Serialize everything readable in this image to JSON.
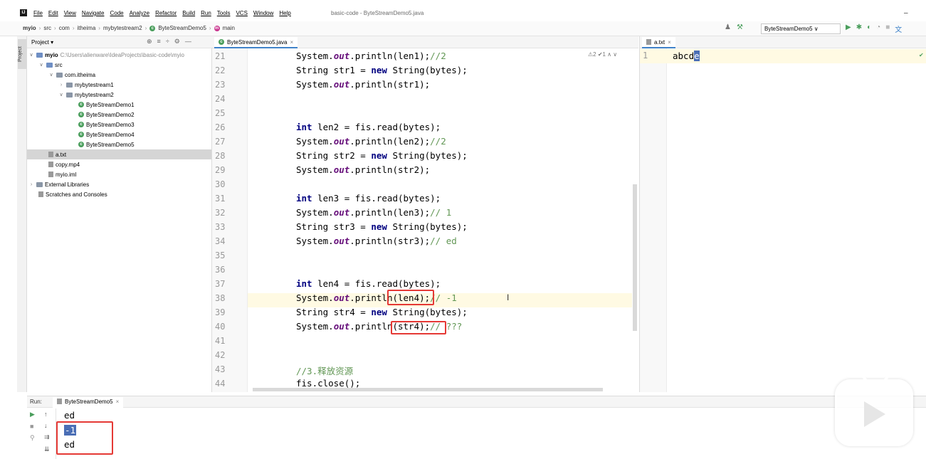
{
  "window": {
    "logo": "IJ",
    "title": "basic-code - ByteStreamDemo5.java",
    "menu": [
      "File",
      "Edit",
      "View",
      "Navigate",
      "Code",
      "Analyze",
      "Refactor",
      "Build",
      "Run",
      "Tools",
      "VCS",
      "Window",
      "Help"
    ],
    "minimize": "–"
  },
  "navbar": {
    "breadcrumbs": [
      "myio",
      "src",
      "com",
      "itheima",
      "mybytestream2",
      "ByteStreamDemo5",
      "main"
    ],
    "run_config": "ByteStreamDemo5 ∨"
  },
  "project": {
    "side_tab": "Project",
    "header": "Project ▾",
    "root_name": "myio",
    "root_path": "C:\\Users\\alienware\\IdeaProjects\\basic-code\\myio",
    "src": "src",
    "package": "com.itheima",
    "pkg1": "mybytestream1",
    "pkg2": "mybytestream2",
    "classes": [
      "ByteStreamDemo1",
      "ByteStreamDemo2",
      "ByteStreamDemo3",
      "ByteStreamDemo4",
      "ByteStreamDemo5"
    ],
    "files": [
      "a.txt",
      "copy.mp4",
      "myio.iml"
    ],
    "external": "External Libraries",
    "scratches": "Scratches and Consoles"
  },
  "editor": {
    "tab": "ByteStreamDemo5.java",
    "inspect": "⚠2 ✔1 ∧ ∨",
    "line_numbers": [
      "21",
      "22",
      "23",
      "24",
      "25",
      "26",
      "27",
      "28",
      "29",
      "30",
      "31",
      "32",
      "33",
      "34",
      "35",
      "36",
      "37",
      "38",
      "39",
      "40",
      "41",
      "42",
      "43",
      "44"
    ],
    "lines": {
      "l21a": "System.",
      "l21b": "out",
      "l21c": ".println(len1);",
      "l21d": "//2",
      "l22a": "String str1 = ",
      "l22b": "new",
      "l22c": " String(bytes);",
      "l23a": "System.",
      "l23b": "out",
      "l23c": ".println(str1);",
      "l26a": "int",
      "l26b": " len2 = fis.read(bytes);",
      "l27a": "System.",
      "l27b": "out",
      "l27c": ".println(len2);",
      "l27d": "//2",
      "l28a": "String str2 = ",
      "l28b": "new",
      "l28c": " String(bytes);",
      "l29a": "System.",
      "l29b": "out",
      "l29c": ".println(str2);",
      "l31a": "int",
      "l31b": " len3 = fis.read(bytes);",
      "l32a": "System.",
      "l32b": "out",
      "l32c": ".println(len3);",
      "l32d": "// 1",
      "l33a": "String str3 = ",
      "l33b": "new",
      "l33c": " String(bytes);",
      "l34a": "System.",
      "l34b": "out",
      "l34c": ".println(str3);",
      "l34d": "// ed",
      "l37a": "int",
      "l37b": " len4 = fis.read(bytes);",
      "l38a": "System.",
      "l38b": "out",
      "l38c": ".println(len4);",
      "l38d": "// -1",
      "l39a": "String str4 = ",
      "l39b": "new",
      "l39c": " String(bytes);",
      "l40a": "System.",
      "l40b": "out",
      "l40c": ".println(str4);",
      "l40d": "// ???",
      "l43": "//3.释放资源",
      "l44": "fis.close();"
    }
  },
  "txt": {
    "tab": "a.txt",
    "line_no": "1",
    "text_plain": "abcd",
    "text_sel": "e"
  },
  "run": {
    "label": "Run:",
    "tab": "ByteStreamDemo5",
    "output": [
      "ed",
      "-1",
      "ed"
    ]
  },
  "colors": {
    "accent": "#4083c9",
    "keyword": "#000080",
    "field": "#660e7a",
    "highlight_box": "#e53935",
    "selection": "#4a6eb5"
  }
}
